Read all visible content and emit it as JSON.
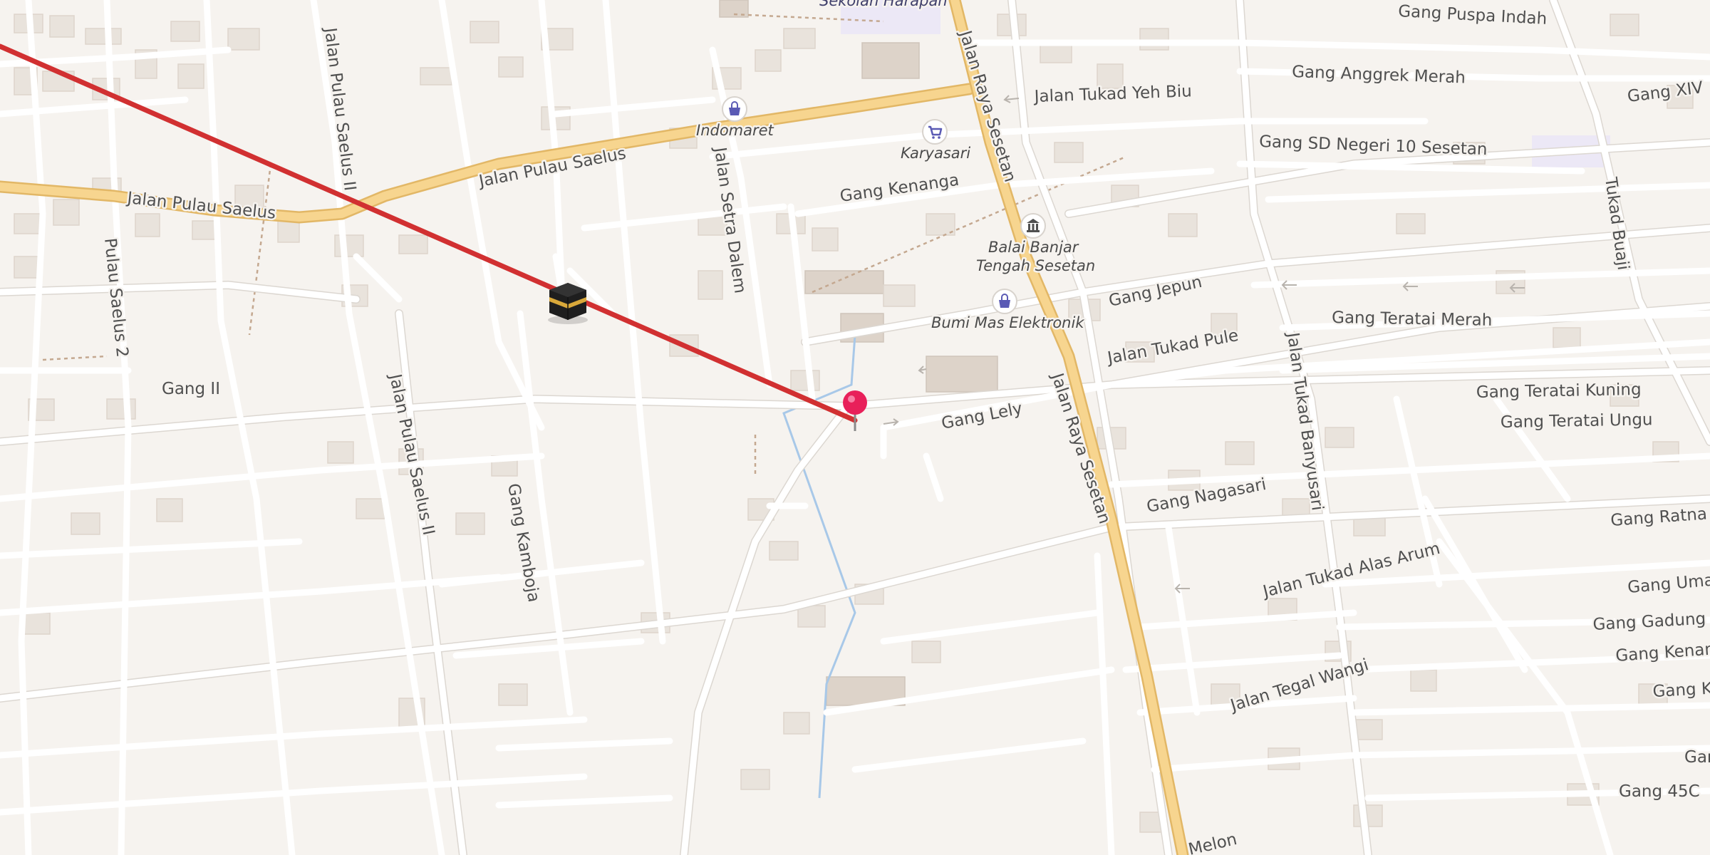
{
  "map": {
    "roads": {
      "jalan_pulau_saelus_west": "Jalan Pulau Saelus",
      "jalan_pulau_saelus_east": "Jalan Pulau Saelus",
      "jalan_pulau_saelus_ii_north": "Jalan Pulau Saelus II",
      "jalan_pulau_saelus_ii_south": "Jalan Pulau Saelus II",
      "pulau_saelus_2": "Pulau Saelus 2",
      "gang_ii": "Gang II",
      "gang_kamboja": "Gang Kamboja",
      "jalan_setra_dalem": "Jalan Setra Dalem",
      "jalan_raya_sesetan_north": "Jalan Raya Sesetan",
      "jalan_raya_sesetan_south": "Jalan Raya Sesetan",
      "gang_kenanga": "Gang Kenanga",
      "jalan_tukad_yeh_biu": "Jalan Tukad Yeh Biu",
      "gang_puspa_indah": "Gang Puspa Indah",
      "gang_anggrek_merah": "Gang Anggrek Merah",
      "gang_xiv": "Gang XIV",
      "gang_sd_negeri": "Gang SD Negeri 10 Sesetan",
      "tukad_buaji": "Tukad Buaji",
      "gang_jepun": "Gang Jepun",
      "gang_teratai_merah": "Gang Teratai Merah",
      "jalan_tukad_pule": "Jalan Tukad Pule",
      "gang_lely": "Gang Lely",
      "jalan_tukad_banyusari": "Jalan Tukad Banyusari",
      "gang_teratai_kuning": "Gang Teratai Kuning",
      "gang_teratai_ungu": "Gang Teratai Ungu",
      "gang_nagasari": "Gang Nagasari",
      "gang_ratna": "Gang Ratna",
      "jalan_tukad_alas_arum": "Jalan Tukad Alas Arum",
      "gang_uma": "Gang Uma",
      "gang_gadung": "Gang Gadung",
      "gang_kenan": "Gang Kenan",
      "jalan_tegal_wangi": "Jalan Tegal Wangi",
      "gang_k": "Gang K",
      "gang_ga": "Gan",
      "gang_45c": "Gang 45C",
      "melon": "Melon"
    },
    "pois": {
      "sekolah_harapan": "Sekolah Harapan",
      "indomaret": "Indomaret",
      "karyasari": "Karyasari",
      "balai_banjar_line1": "Balai Banjar",
      "balai_banjar_line2": "Tengah Sesetan",
      "bumi_mas": "Bumi Mas Elektronik"
    },
    "icons": {
      "qibla": "kaaba-icon",
      "location": "location-pin-icon",
      "shop": "shopping-bag-icon",
      "cart": "shopping-cart-icon",
      "hall": "town-hall-icon"
    },
    "colors": {
      "background": "#f6f3ef",
      "major_road": "#f7d58f",
      "minor_road": "#ffffff",
      "qibla_line": "#d13031",
      "pin": "#e8205a",
      "poi_icon": "#5a5ab4"
    }
  }
}
